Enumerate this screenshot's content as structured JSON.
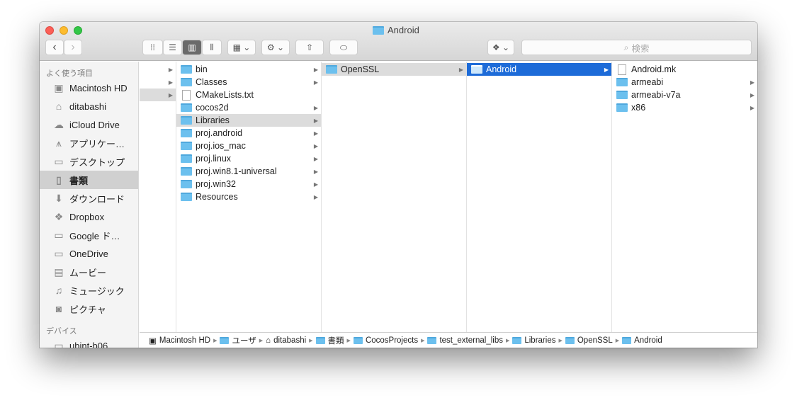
{
  "window": {
    "title": "Android"
  },
  "toolbar": {
    "search_placeholder": "検索"
  },
  "sidebar": {
    "favorites_header": "よく使う項目",
    "items": [
      {
        "label": "Macintosh HD",
        "icon": "hd-icon"
      },
      {
        "label": "ditabashi",
        "icon": "home-icon"
      },
      {
        "label": "iCloud Drive",
        "icon": "cloud-icon"
      },
      {
        "label": "アプリケー…",
        "icon": "applications-icon"
      },
      {
        "label": "デスクトップ",
        "icon": "desktop-icon"
      },
      {
        "label": "書類",
        "icon": "documents-icon",
        "selected": true
      },
      {
        "label": "ダウンロード",
        "icon": "download-icon"
      },
      {
        "label": "Dropbox",
        "icon": "dropbox-icon"
      },
      {
        "label": "Google ド…",
        "icon": "folder-icon"
      },
      {
        "label": "OneDrive",
        "icon": "folder-icon"
      },
      {
        "label": "ムービー",
        "icon": "movie-icon"
      },
      {
        "label": "ミュージック",
        "icon": "music-icon"
      },
      {
        "label": "ピクチャ",
        "icon": "camera-icon"
      }
    ],
    "devices_header": "デバイス",
    "devices": [
      {
        "label": "ubint-b06"
      }
    ]
  },
  "columns": {
    "col1": [
      "bin",
      "Classes",
      "CMakeLists.txt",
      "cocos2d",
      "Libraries",
      "proj.android",
      "proj.ios_mac",
      "proj.linux",
      "proj.win8.1-universal",
      "proj.win32",
      "Resources"
    ],
    "col2": [
      "OpenSSL"
    ],
    "col3": [
      "Android"
    ],
    "col4": [
      "Android.mk",
      "armeabi",
      "armeabi-v7a",
      "x86"
    ]
  },
  "pathbar": [
    "Macintosh HD",
    "ユーザ",
    "ditabashi",
    "書類",
    "CocosProjects",
    "test_external_libs",
    "Libraries",
    "OpenSSL",
    "Android"
  ]
}
